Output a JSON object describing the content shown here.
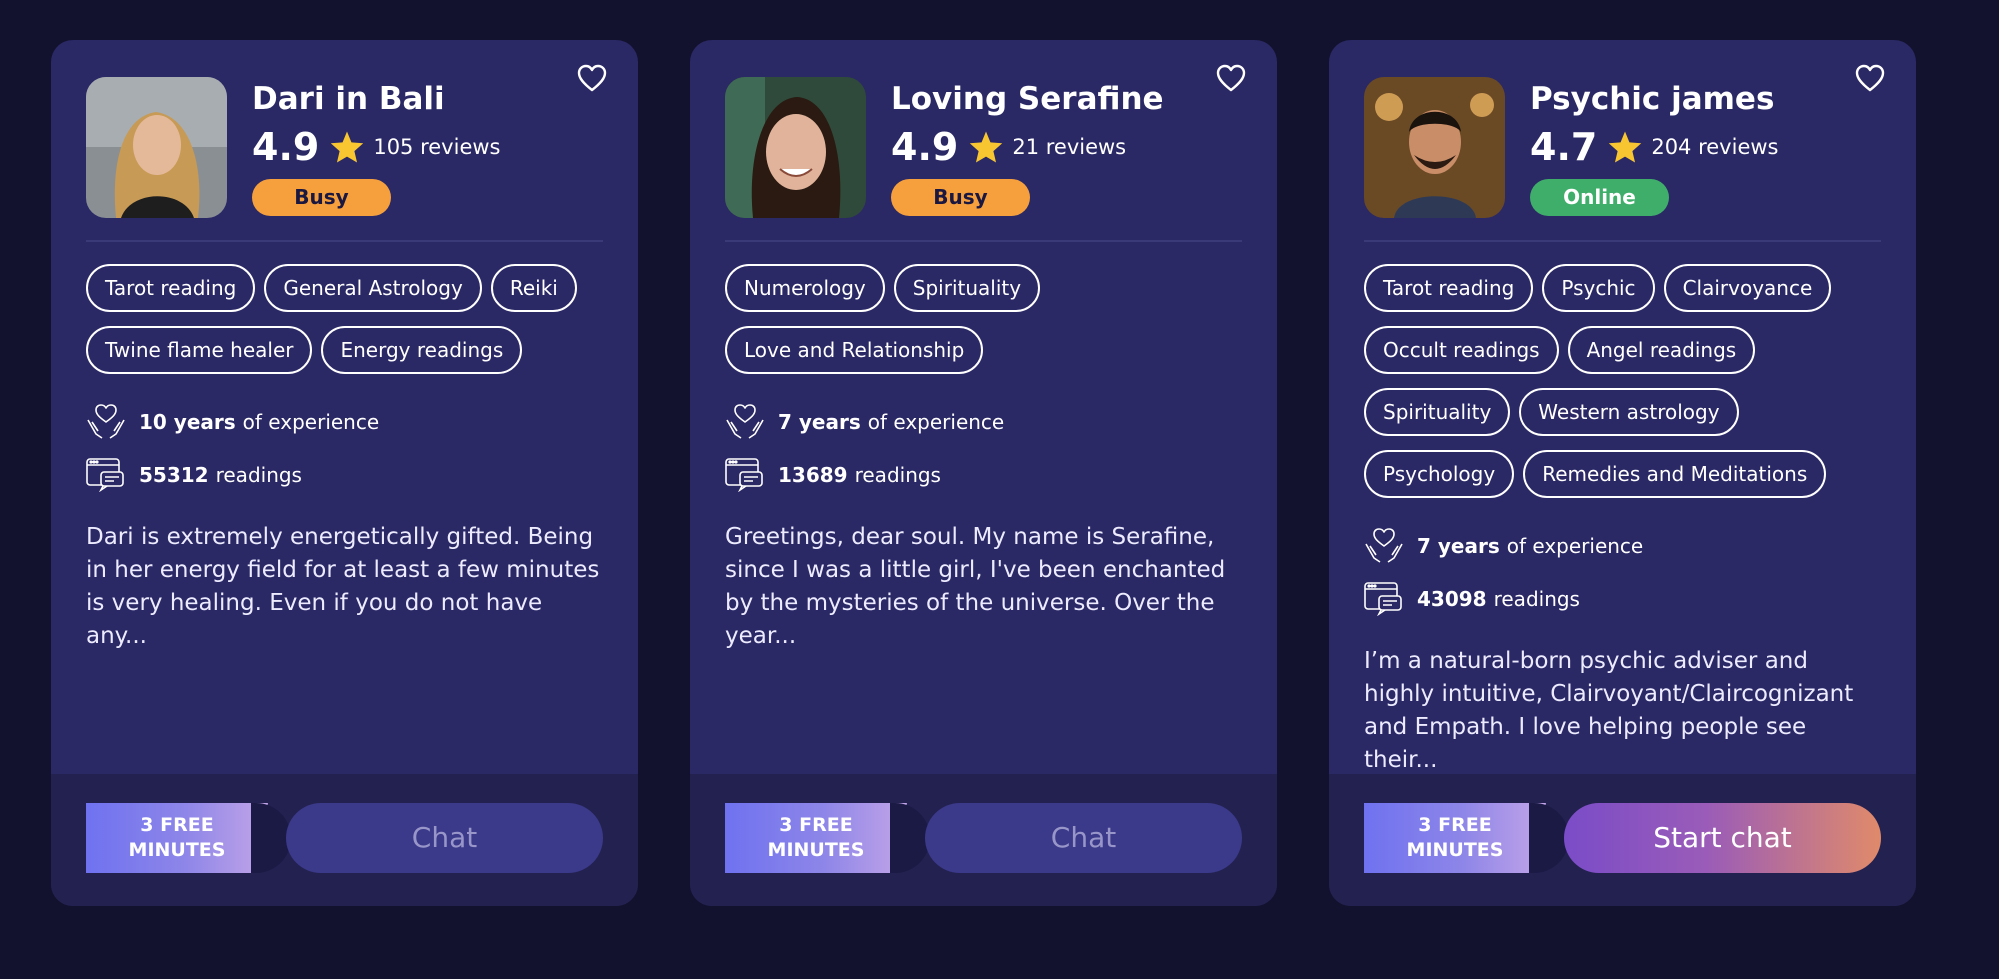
{
  "cards": [
    {
      "name": "Dari in Bali",
      "rating": "4.9",
      "reviews": "105 reviews",
      "status": "Busy",
      "tags": [
        "Tarot reading",
        "General Astrology",
        "Reiki",
        "Twine flame healer",
        "Energy readings"
      ],
      "experience_value": "10 years",
      "experience_suffix": "of experience",
      "readings_value": "55312",
      "readings_suffix": "readings",
      "description": "Dari is extremely energetically gifted. Being in her energy field for at least a few minutes is very healing. Even if you do not have any...",
      "free_line1": "3 FREE",
      "free_line2": "MINUTES",
      "chat_label": "Chat"
    },
    {
      "name": "Loving Serafine",
      "rating": "4.9",
      "reviews": "21 reviews",
      "status": "Busy",
      "tags": [
        "Numerology",
        "Spirituality",
        "Love and Relationship"
      ],
      "experience_value": "7 years",
      "experience_suffix": "of experience",
      "readings_value": "13689",
      "readings_suffix": "readings",
      "description": "Greetings, dear soul. My name is Serafine, since I was a little girl, I've been enchanted by the mysteries of the universe. Over the year...",
      "free_line1": "3 FREE",
      "free_line2": "MINUTES",
      "chat_label": "Chat"
    },
    {
      "name": "Psychic james",
      "rating": "4.7",
      "reviews": "204 reviews",
      "status": "Online",
      "tags": [
        "Tarot reading",
        "Psychic",
        "Clairvoyance",
        "Occult readings",
        "Angel readings",
        "Spirituality",
        "Western astrology",
        "Psychology",
        "Remedies and Meditations"
      ],
      "experience_value": "7 years",
      "experience_suffix": "of experience",
      "readings_value": "43098",
      "readings_suffix": "readings",
      "description": "I’m a natural-born psychic adviser and highly intuitive, Clairvoyant/Claircognizant and Empath. I love helping people see their...",
      "free_line1": "3 FREE",
      "free_line2": "MINUTES",
      "chat_label": "Start chat"
    }
  ],
  "colors": {
    "background": "#13122e",
    "card": "#2a2865",
    "busy": "#f5a03d",
    "online": "#3fae6a",
    "star": "#f7c631"
  },
  "icons": [
    "heart-outline-icon",
    "star-icon",
    "hands-heart-icon",
    "chat-window-icon"
  ]
}
